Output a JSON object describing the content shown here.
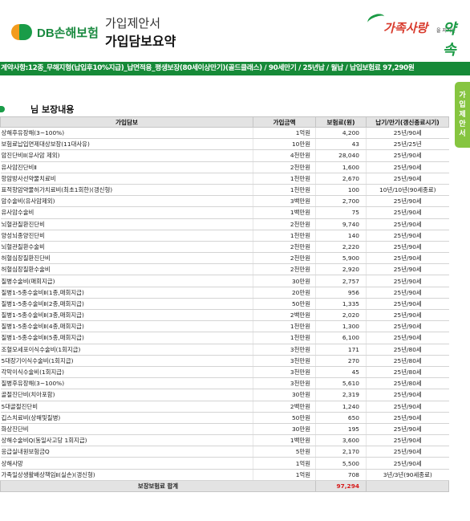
{
  "header": {
    "logo_text": "DB손해보험",
    "doc_subtitle": "가입제안서",
    "doc_title": "가입담보요약",
    "slogan_part1": "가족사랑",
    "slogan_small": "을 지키는",
    "slogan_part2": "약속"
  },
  "banner": {
    "text": "계약사항:12종_무해지형(납입후10%지급)_납면적용_평생보장(80세이상만기)(골드클래스) / 90세만기 / 25년납 / 월납 / 납입보험료 97,290원"
  },
  "side_tab": {
    "label": [
      "가",
      "입",
      "제",
      "안",
      "서"
    ]
  },
  "section": {
    "title": "님 보장내용"
  },
  "table": {
    "headers": [
      "가입담보",
      "가입금액",
      "보험료(원)",
      "납기/만기(갱신종료시기)"
    ],
    "rows": [
      [
        "상해후유장해(3~100%)",
        "1억원",
        "4,200",
        "25년/90세"
      ],
      [
        "보험료납입면제대상보장(11대사유)",
        "10만원",
        "43",
        "25년/25년"
      ],
      [
        "암진단비Ⅱ(유사암 제외)",
        "4천만원",
        "28,040",
        "25년/90세"
      ],
      [
        "유사암진단비Ⅱ",
        "2천만원",
        "1,600",
        "25년/90세"
      ],
      [
        "항암방사선약물치료비",
        "1천만원",
        "2,670",
        "25년/90세"
      ],
      [
        "표적항암약물허가치료비(최초1회한)(갱신형)",
        "1천만원",
        "100",
        "10년/10년(90세종료)"
      ],
      [
        "암수술비(유사암제외)",
        "3백만원",
        "2,700",
        "25년/90세"
      ],
      [
        "유사암수술비",
        "1백만원",
        "75",
        "25년/90세"
      ],
      [
        "뇌혈관질환진단비",
        "2천만원",
        "9,740",
        "25년/90세"
      ],
      [
        "양성뇌종양진단비",
        "1천만원",
        "140",
        "25년/90세"
      ],
      [
        "뇌혈관질환수술비",
        "2천만원",
        "2,220",
        "25년/90세"
      ],
      [
        "허혈심장질환진단비",
        "2천만원",
        "5,900",
        "25년/90세"
      ],
      [
        "허혈심장질환수술비",
        "2천만원",
        "2,920",
        "25년/90세"
      ],
      [
        "질병수술비(매회지급)",
        "30만원",
        "2,757",
        "25년/90세"
      ],
      [
        "질병1-5종수술비Ⅱ(1종,매회지급)",
        "20만원",
        "956",
        "25년/90세"
      ],
      [
        "질병1-5종수술비Ⅱ(2종,매회지급)",
        "50만원",
        "1,335",
        "25년/90세"
      ],
      [
        "질병1-5종수술비Ⅱ(3종,매회지급)",
        "2백만원",
        "2,020",
        "25년/90세"
      ],
      [
        "질병1-5종수술비Ⅱ(4종,매회지급)",
        "1천만원",
        "1,300",
        "25년/90세"
      ],
      [
        "질병1-5종수술비Ⅱ(5종,매회지급)",
        "1천만원",
        "6,100",
        "25년/90세"
      ],
      [
        "조혈모세포이식수술비(1회지급)",
        "3천만원",
        "171",
        "25년/80세"
      ],
      [
        "5대장기이식수술비(1회지급)",
        "3천만원",
        "270",
        "25년/80세"
      ],
      [
        "각막이식수술비(1회지급)",
        "3천만원",
        "45",
        "25년/80세"
      ],
      [
        "질병후유장해(3~100%)",
        "3천만원",
        "5,610",
        "25년/80세"
      ],
      [
        "골절진단비(치아포함)",
        "30만원",
        "2,319",
        "25년/90세"
      ],
      [
        "5대골절진단비",
        "2백만원",
        "1,240",
        "25년/90세"
      ],
      [
        "깁스치료비(상해및질병)",
        "50만원",
        "650",
        "25년/90세"
      ],
      [
        "화상진단비",
        "30만원",
        "195",
        "25년/90세"
      ],
      [
        "상해수술비Q(동일사고당 1회지급)",
        "1백만원",
        "3,600",
        "25년/90세"
      ],
      [
        "응급실내원보험금Q",
        "5만원",
        "2,170",
        "25년/90세"
      ],
      [
        "상해사망",
        "1억원",
        "5,500",
        "25년/90세"
      ],
      [
        "가족일상생활배상책임Ⅱ(실손)(갱신형)",
        "1억원",
        "708",
        "3년/3년(90세종료)"
      ]
    ],
    "total_label": "보장보험료 합계",
    "total_value": "97,294"
  }
}
